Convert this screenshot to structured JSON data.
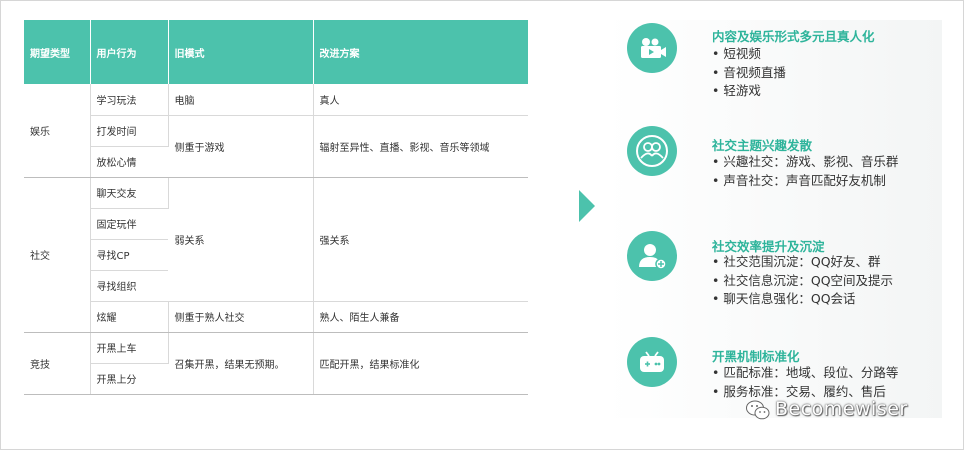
{
  "table": {
    "headers": [
      "期望类型",
      "用户行为",
      "旧模式",
      "改进方案"
    ],
    "groups": [
      {
        "type": "娱乐",
        "rows": [
          {
            "behavior": "学习玩法",
            "old": "电脑",
            "new": "真人"
          },
          {
            "behavior": "打发时间",
            "old": "侧重于游戏",
            "new": "辐射至异性、直播、影视、音乐等领域"
          },
          {
            "behavior": "放松心情"
          }
        ]
      },
      {
        "type": "社交",
        "rows": [
          {
            "behavior": "聊天交友",
            "old": "弱关系",
            "new": "强关系"
          },
          {
            "behavior": "固定玩伴"
          },
          {
            "behavior": "寻找CP"
          },
          {
            "behavior": "寻找组织"
          },
          {
            "behavior": "炫耀",
            "old": "侧重于熟人社交",
            "new": "熟人、陌生人兼备"
          }
        ]
      },
      {
        "type": "竞技",
        "rows": [
          {
            "behavior": "开黑上车",
            "old": "召集开黑，结果无预期。",
            "new": "匹配开黑，结果标准化"
          },
          {
            "behavior": "开黑上分"
          }
        ]
      }
    ]
  },
  "cards": [
    {
      "icon": "video-camera-icon",
      "title": "内容及娱乐形式多元且真人化",
      "bullets": [
        "短视频",
        "音视频直播",
        "轻游戏"
      ]
    },
    {
      "icon": "people-group-icon",
      "title": "社交主题兴趣发散",
      "bullets": [
        "兴趣社交：游戏、影视、音乐群",
        "声音社交：声音匹配好友机制"
      ]
    },
    {
      "icon": "add-user-icon",
      "title": "社交效率提升及沉淀",
      "bullets": [
        "社交范围沉淀：QQ好友、群",
        "社交信息沉淀：QQ空间及提示",
        "聊天信息强化：QQ会话"
      ]
    },
    {
      "icon": "gamepad-icon",
      "title": "开黑机制标准化",
      "bullets": [
        "匹配标准：地域、段位、分路等",
        "服务标准：交易、履约、售后"
      ]
    }
  ],
  "watermark": "Becomewiser",
  "colors": {
    "accent": "#4cc2ac",
    "title": "#2eb49b",
    "text": "#333333"
  }
}
